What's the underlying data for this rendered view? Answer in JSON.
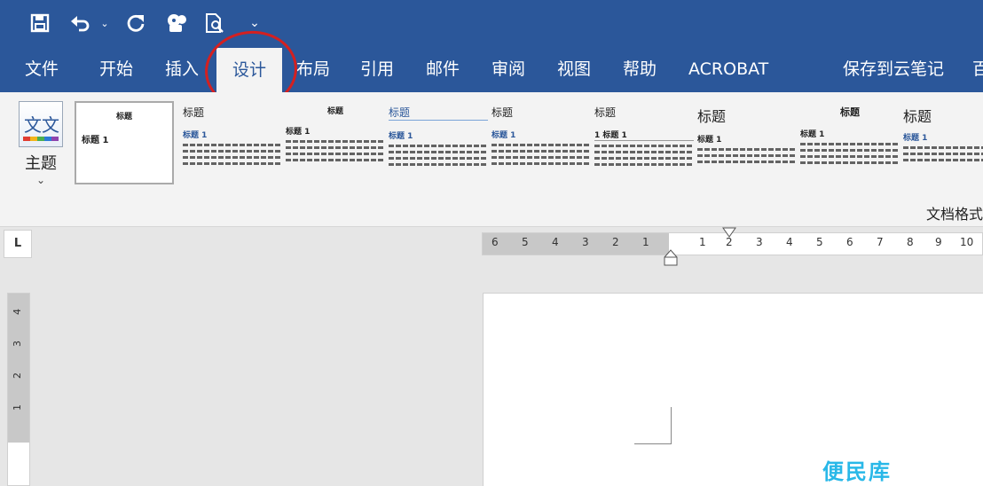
{
  "tabs": [
    {
      "label": "文件"
    },
    {
      "label": "开始"
    },
    {
      "label": "插入"
    },
    {
      "label": "设计"
    },
    {
      "label": "布局"
    },
    {
      "label": "引用"
    },
    {
      "label": "邮件"
    },
    {
      "label": "审阅"
    },
    {
      "label": "视图"
    },
    {
      "label": "帮助"
    },
    {
      "label": "ACROBAT"
    },
    {
      "label": "保存到云笔记"
    },
    {
      "label": "百"
    }
  ],
  "active_tab": "设计",
  "ribbon": {
    "theme_icon_text": "文文",
    "theme_label": "主题",
    "theme_arrow": "⌄",
    "gallery": [
      {
        "title": "标题",
        "heading": "标题 1"
      },
      {
        "title": "标题",
        "heading": "标题 1"
      },
      {
        "title": "标题",
        "heading": "标题 1"
      },
      {
        "title": "标题",
        "heading": "标题 1"
      },
      {
        "title": "标题",
        "heading": "标题 1"
      },
      {
        "title": "标题",
        "heading": "1 标题 1"
      },
      {
        "title": "标题",
        "heading": "标题 1"
      },
      {
        "title": "标题",
        "heading": "标题 1"
      },
      {
        "title": "标题",
        "heading": "标题 1"
      }
    ],
    "group_label": "文档格式"
  },
  "ruler": {
    "corner": "L",
    "h_left": [
      "6",
      "5",
      "4",
      "3",
      "2",
      "1"
    ],
    "h_right": [
      "1",
      "2",
      "3",
      "4",
      "5",
      "6",
      "7",
      "8",
      "9",
      "10"
    ],
    "v_marks": [
      "4",
      "3",
      "2",
      "1"
    ]
  },
  "watermark": "便民库",
  "colors": {
    "accent": "#2b579a",
    "highlight": "#d42020",
    "watermark": "#29b8e8"
  }
}
